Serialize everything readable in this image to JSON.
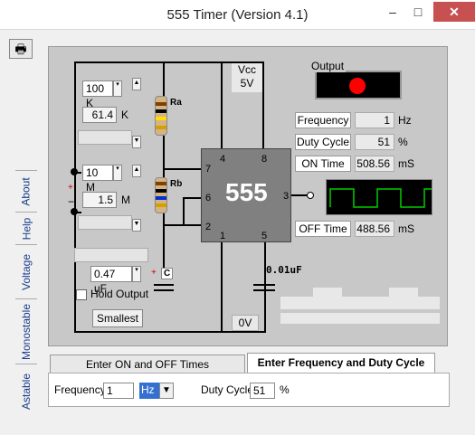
{
  "window": {
    "title": "555 Timer  (Version 4.1)",
    "minimize": "–",
    "maximize": "□",
    "close": "✕"
  },
  "toolbar": {
    "print_icon": "🖶"
  },
  "vertical_tabs": [
    "About",
    "Help",
    "Voltage",
    "Monostable",
    "Astable"
  ],
  "circuit": {
    "vcc_label": "Vcc",
    "vcc_value": "5V",
    "zero_volt": "0V",
    "ra_select": "100 K",
    "ra_value": "61.4",
    "ra_unit": "K",
    "ra_label": "Ra",
    "rb_select": "10 M",
    "rb_value": "1.5",
    "rb_unit": "M",
    "rb_label": "Rb",
    "cap_select": "0.47 uF",
    "cap_label": "C",
    "cap2_value": "0.01uF",
    "hold_output": "Hold Output",
    "smallest": "Smallest",
    "chip": "555",
    "pins": {
      "p4": "4",
      "p8": "8",
      "p7": "7",
      "p6": "6",
      "p2": "2",
      "p1": "1",
      "p5": "5",
      "p3": "3"
    },
    "plus": "+",
    "minus": "−"
  },
  "output": {
    "label": "Output",
    "frequency_label": "Frequency",
    "frequency_value": "1",
    "frequency_unit": "Hz",
    "duty_label": "Duty Cycle",
    "duty_value": "51",
    "duty_unit": "%",
    "on_label": "ON Time",
    "on_value": "508.56",
    "on_unit": "mS",
    "off_label": "OFF Time",
    "off_value": "488.56",
    "off_unit": "mS"
  },
  "tabs": {
    "on_off": "Enter ON and OFF Times",
    "freq_duty": "Enter Frequency and Duty Cycle"
  },
  "inputs": {
    "frequency_label": "Frequency",
    "frequency_value": "1",
    "frequency_unit": "Hz",
    "duty_label": "Duty Cycle",
    "duty_value": "51",
    "duty_unit": "%"
  },
  "colors": {
    "led": "#ff0000",
    "scope_bg": "#000000",
    "scope_wave": "#00cc00",
    "tab_text": "#1a3e8c"
  }
}
